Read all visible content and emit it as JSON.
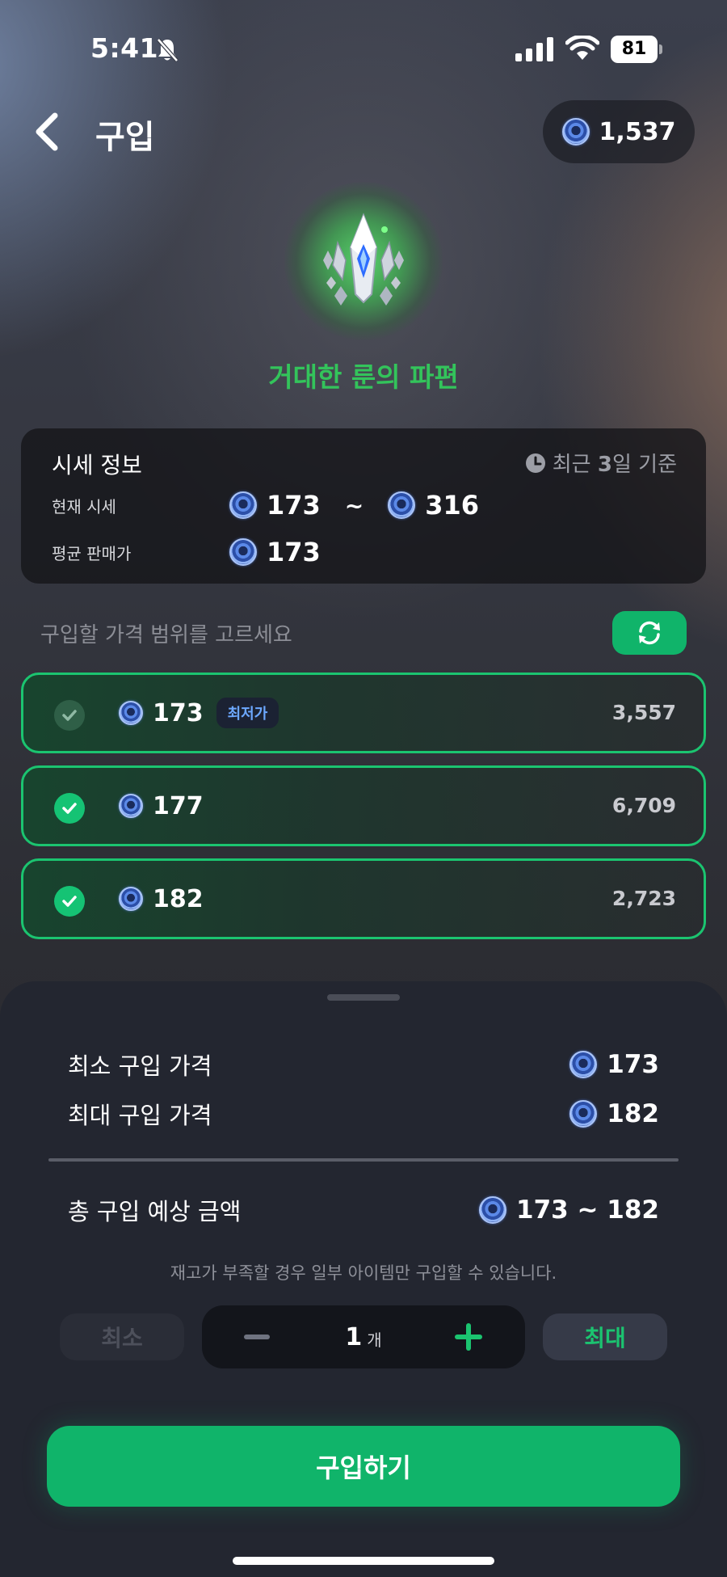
{
  "status_bar": {
    "time": "5:41",
    "battery": "81",
    "icons": [
      "bell-slash-icon",
      "signal-icon",
      "wifi-icon",
      "battery-icon"
    ]
  },
  "header": {
    "title": "구입",
    "balance": "1,537",
    "icons": [
      "chevron-left-icon",
      "coin-icon"
    ]
  },
  "item": {
    "name": "거대한 룬의 파편",
    "name_color": "#33c45b",
    "icon": "rune-crystal-icon"
  },
  "price_info": {
    "title": "시세 정보",
    "period": {
      "prefix": "최근 ",
      "days": "3",
      "suffix": "일 기준"
    },
    "current_label": "현재 시세",
    "current_min": "173",
    "current_tilde": "~",
    "current_max": "316",
    "average_label": "평균 판매가",
    "average_value": "173"
  },
  "selection": {
    "prompt": "구입할 가격 범위를 고르세요",
    "refresh_icon": "refresh-icon",
    "options": [
      {
        "price": "173",
        "badge": "최저가",
        "quantity": "3,557",
        "checked": true
      },
      {
        "price": "177",
        "quantity": "6,709",
        "checked": true
      },
      {
        "price": "182",
        "quantity": "2,723",
        "checked": true
      }
    ]
  },
  "summary": {
    "min_label": "최소 구입 가격",
    "min_value": "173",
    "max_label": "최대 구입 가격",
    "max_value": "182",
    "total_label": "총 구입 예상 금액",
    "total_value": "173 ~ 182",
    "notice": "재고가 부족할 경우 일부 아이템만 구입할 수 있습니다."
  },
  "quantity": {
    "min_label": "최소",
    "max_label": "최대",
    "value": "1",
    "unit": "개"
  },
  "buy_label": "구입하기",
  "colors": {
    "accent": "#10b46a",
    "option_border": "#1bc470",
    "badge_text": "#6ca8ff",
    "sheet_bg": "#232630"
  }
}
